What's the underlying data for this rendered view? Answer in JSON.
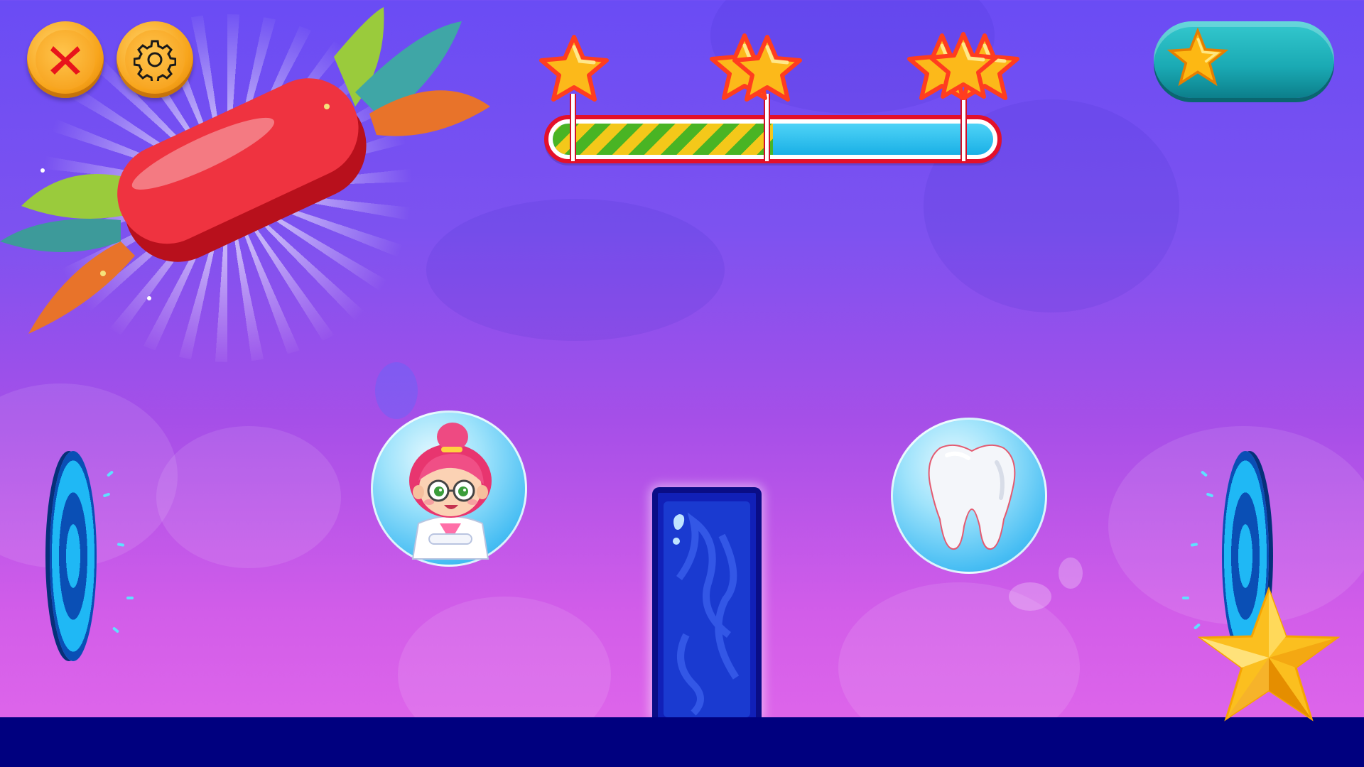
{
  "hud": {
    "close_icon": "close-x-icon",
    "settings_icon": "gear-icon",
    "score_icon": "star-icon",
    "score_value": ""
  },
  "progress": {
    "fill_fraction": 0.5,
    "milestones": [
      {
        "stars": 1
      },
      {
        "stars": 2
      },
      {
        "stars": 3
      }
    ]
  },
  "scene": {
    "left_bubble": "doctor-girl-character",
    "right_bubble": "tooth-icon",
    "collectible": "gold-star",
    "candy": "red-candy-powerup"
  },
  "colors": {
    "ground": "#00007f",
    "pillar": "#1120b8",
    "progress_border": "#e4102a",
    "button_orange": "#f8a51c",
    "pill_teal": "#1aa9b3"
  }
}
